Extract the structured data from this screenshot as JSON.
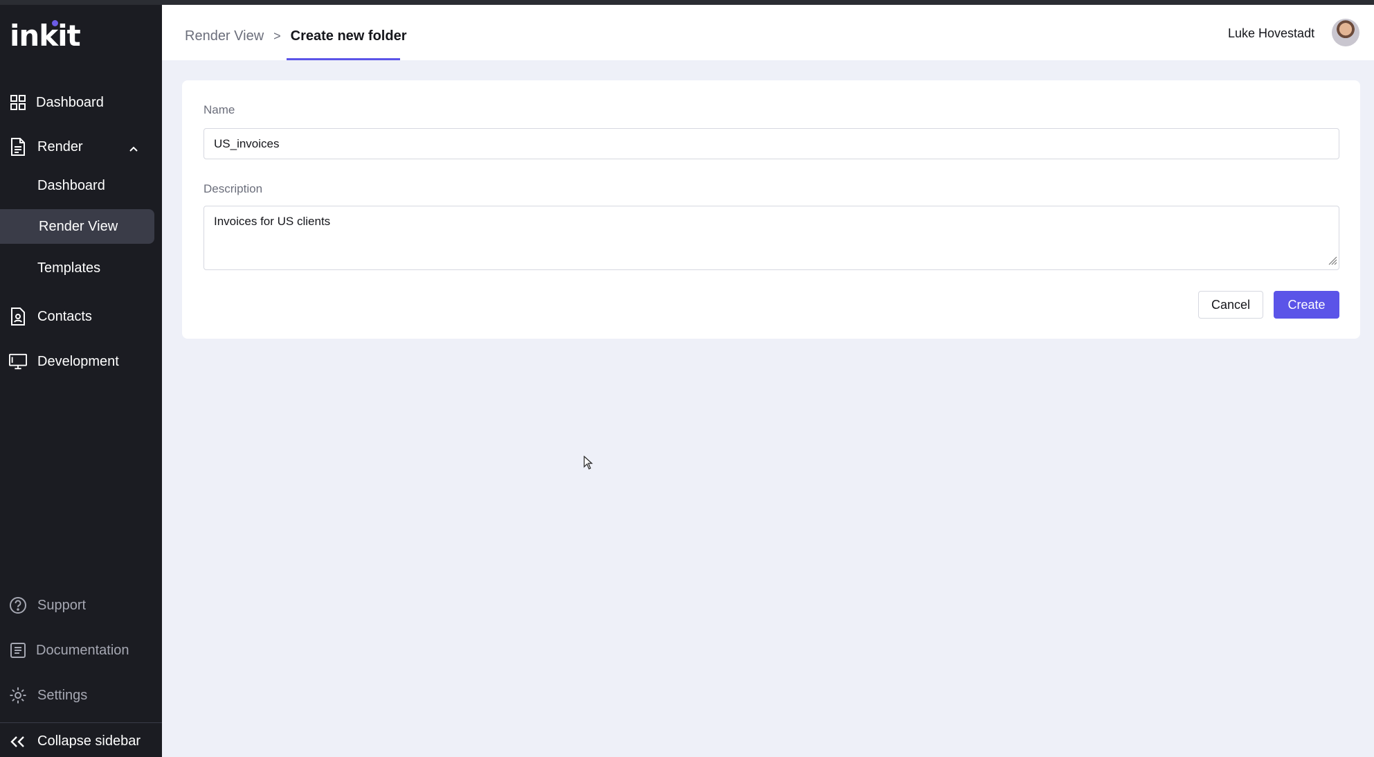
{
  "brand": {
    "logo": "inkit",
    "accent": "#5b54e8"
  },
  "sidebar": {
    "items": [
      {
        "label": "Dashboard",
        "icon": "grid-icon"
      },
      {
        "label": "Render",
        "icon": "document-icon",
        "expanded": true
      },
      {
        "label": "Dashboard"
      },
      {
        "label": "Render View",
        "active": true
      },
      {
        "label": "Templates"
      },
      {
        "label": "Contacts",
        "icon": "contact-icon"
      },
      {
        "label": "Development",
        "icon": "monitor-icon"
      }
    ],
    "footer": [
      {
        "label": "Support",
        "icon": "help-circle-icon"
      },
      {
        "label": "Documentation",
        "icon": "list-doc-icon"
      },
      {
        "label": "Settings",
        "icon": "gear-icon"
      }
    ],
    "collapse_label": "Collapse sidebar"
  },
  "header": {
    "breadcrumb": {
      "parent": "Render View",
      "separator": ">",
      "current": "Create new folder"
    },
    "user_name": "Luke Hovestadt"
  },
  "form": {
    "name_label": "Name",
    "name_value": "US_invoices",
    "description_label": "Description",
    "description_value": "Invoices for US clients",
    "cancel_label": "Cancel",
    "create_label": "Create"
  }
}
